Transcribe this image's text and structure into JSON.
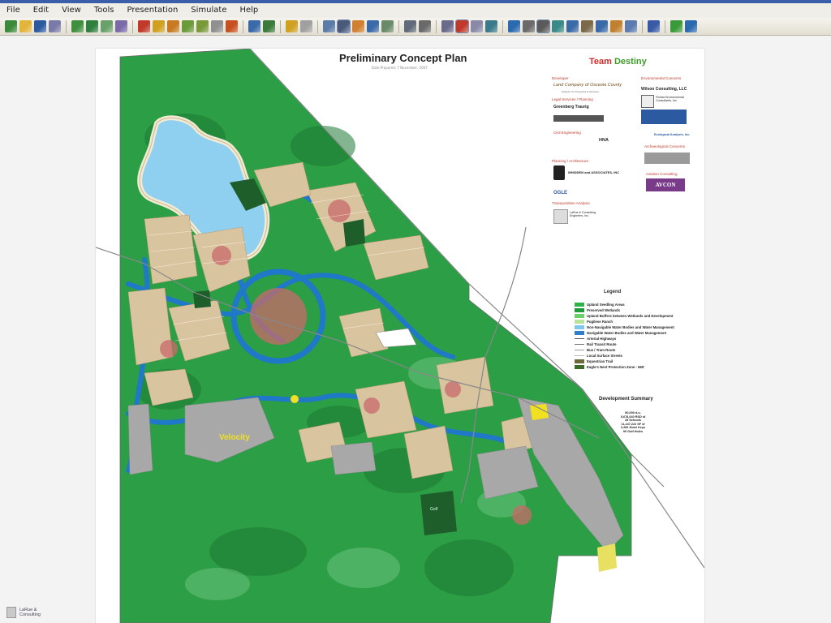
{
  "menu": [
    "File",
    "Edit",
    "View",
    "Tools",
    "Presentation",
    "Simulate",
    "Help"
  ],
  "toolbar": {
    "groups": [
      [
        {
          "icon": "new-icon",
          "color": "#3a8a3a"
        },
        {
          "icon": "open-icon",
          "color": "#e2b43a"
        },
        {
          "icon": "save-icon",
          "color": "#2c5aa0"
        },
        {
          "icon": "export-icon",
          "color": "#7a7aa8"
        }
      ],
      [
        {
          "icon": "shape-icon",
          "color": "#3f8f3f"
        },
        {
          "icon": "shape2-icon",
          "color": "#2f7f3f"
        },
        {
          "icon": "layer-icon",
          "color": "#6aa06a"
        },
        {
          "icon": "object-icon",
          "color": "#7a6aa8"
        }
      ],
      [
        {
          "icon": "tree-icon",
          "color": "#c0392b"
        },
        {
          "icon": "zoom-icon",
          "color": "#d0a020"
        },
        {
          "icon": "pin-icon",
          "color": "#c87a20"
        },
        {
          "icon": "road-icon",
          "color": "#6a9a3a"
        },
        {
          "icon": "terrain-icon",
          "color": "#7a9a3a"
        },
        {
          "icon": "page-icon",
          "color": "#909090"
        },
        {
          "icon": "record-icon",
          "color": "#c85020"
        }
      ],
      [
        {
          "icon": "camera-icon",
          "color": "#3a6aa8"
        },
        {
          "icon": "model-icon",
          "color": "#3a7a3a"
        }
      ],
      [
        {
          "icon": "help-icon",
          "color": "#d0a020"
        },
        {
          "icon": "grid-icon",
          "color": "#a0a0a0"
        }
      ],
      [
        {
          "icon": "edit-icon",
          "color": "#5a7aa8"
        },
        {
          "icon": "table-icon",
          "color": "#4a5a7a",
          "active": true
        },
        {
          "icon": "tools-icon",
          "color": "#d08030"
        },
        {
          "icon": "globe-icon",
          "color": "#3a6aa8"
        },
        {
          "icon": "image-icon",
          "color": "#6a8a6a"
        }
      ],
      [
        {
          "icon": "road-tool-icon",
          "color": "#606a7a"
        },
        {
          "icon": "vehicle-icon",
          "color": "#6a6a6a"
        }
      ],
      [
        {
          "icon": "settings-icon",
          "color": "#6a6a8a"
        },
        {
          "icon": "rotate-icon",
          "color": "#c0392b",
          "active": true
        },
        {
          "icon": "eraser-icon",
          "color": "#8a8aa8"
        },
        {
          "icon": "copy-icon",
          "color": "#3a7a8a"
        }
      ],
      [
        {
          "icon": "cube-icon",
          "color": "#2c6ab0"
        },
        {
          "icon": "stack-icon",
          "color": "#6a6a6a"
        },
        {
          "icon": "hand-icon",
          "color": "#5a5a5a",
          "active": true
        },
        {
          "icon": "orbit-icon",
          "color": "#3a8a8a"
        },
        {
          "icon": "house-icon",
          "color": "#3a6aa8"
        },
        {
          "icon": "align-icon",
          "color": "#7a6a4a"
        },
        {
          "icon": "person-icon",
          "color": "#3a6aa8"
        },
        {
          "icon": "paint-icon",
          "color": "#c08030"
        },
        {
          "icon": "doc-icon",
          "color": "#5a7ab0"
        }
      ],
      [
        {
          "icon": "info-icon",
          "color": "#3a5aa8"
        }
      ],
      [
        {
          "icon": "leaf-icon",
          "color": "#3a9a3a"
        },
        {
          "icon": "globe2-icon",
          "color": "#2c6ab0"
        }
      ]
    ]
  },
  "doc": {
    "title": "Preliminary Concept Plan",
    "subtitle": "Date Prepared: 7 November, 2007",
    "team_word1": "Team",
    "team_word2": "Destiny",
    "sections": {
      "developer": "Developer",
      "legal": "Legal Services / Planning",
      "civil": "Civil Engineering",
      "planning": "Planning / Architecture",
      "transport": "Transportation Analysis",
      "environmental": "Environmental Concerns",
      "archaeological": "Archaeological Concerns",
      "aviation": "Aviation Consulting"
    },
    "firms": {
      "land_company": "Land Company of Osceola County",
      "land_sub": "Orlando, FL Properties & Ventures",
      "greenberg": "Greenberg Traurig",
      "hna": "HNA",
      "wilson": "Wilson Consulting, LLC",
      "wilson_sub": "Florida Environmental Consultants, Inc.",
      "ecological": "Ecological Analysts, Inc.",
      "wm": "WHIDDEN and ASSOCIATES, INC",
      "ogle": "OGLE",
      "lassiter": "LaRue & Consulting Engineers, Inc.",
      "avcon": "AVCON"
    },
    "legend_title": "Legend",
    "legend": [
      {
        "label": "Upland Seedling Areas",
        "color": "#2fb14a",
        "kind": "box"
      },
      {
        "label": "Preserved Wetlands",
        "color": "#1f9a3a",
        "kind": "box"
      },
      {
        "label": "Upland Buffers between Wetlands and Development",
        "color": "#6ad06a",
        "kind": "box"
      },
      {
        "label": "Pugilese Ranch",
        "color": "#b9e29a",
        "kind": "box"
      },
      {
        "label": "Non-Navigable Water Bodies and Water Management",
        "color": "#7fc8ec",
        "kind": "box"
      },
      {
        "label": "Navigable Water Bodies and Water Management",
        "color": "#2e7fc8",
        "kind": "box"
      },
      {
        "label": "Arterial Highways",
        "color": "#555555",
        "kind": "line"
      },
      {
        "label": "Rail Transit Route",
        "color": "#777777",
        "kind": "line"
      },
      {
        "label": "Bus / Tram Route",
        "color": "#999999",
        "kind": "line"
      },
      {
        "label": "Local Surface Streets",
        "color": "#bbbbbb",
        "kind": "line"
      },
      {
        "label": "Equestrian Trail",
        "color": "#6b6b3a",
        "kind": "box"
      },
      {
        "label": "Eagle's Nest Protection Zone - 660'",
        "color": "#3d6b2a",
        "kind": "box"
      }
    ],
    "dev_title": "Development Summary",
    "dev_lines": [
      "80,000 d.u.",
      "5,678,640 RSD sf",
      "28 Schools",
      "11,247,222 SF sf",
      "3,266 Hotel Keys",
      "90 Golf Holes"
    ],
    "map_labels": {
      "velocity": "Velocity",
      "golf": "Golf"
    }
  },
  "corner": {
    "line1": "LaRue &",
    "line2": "Consulting"
  },
  "colors": {
    "forest": "#2c9e46",
    "forest_dark": "#1d7a34",
    "water": "#1f78c8",
    "lake": "#8fd0f0",
    "dev": "#d9c4a0",
    "dev_red": "#c86a6a",
    "gray_zone": "#a8a8a8"
  }
}
